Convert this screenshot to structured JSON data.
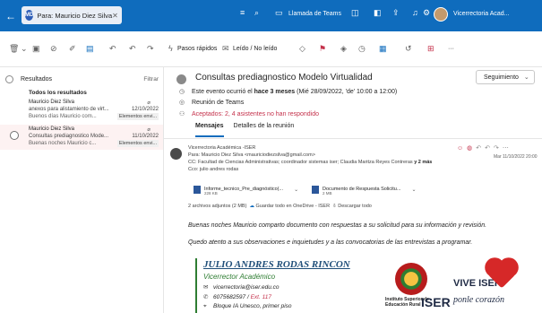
{
  "topbar": {
    "tab_initials": "MD",
    "tab_label": "Para: Mauricio Diez Silva",
    "close": "✕",
    "call_label": "Llamada de Teams",
    "account_label": "Vicerrectoria Acad..."
  },
  "ribbon": {
    "quick_steps": "Pasos rápidos",
    "read_unread": "Leído / No leído",
    "more": "···"
  },
  "list": {
    "header": "Resultados",
    "filter": "Filtrar",
    "all_results": "Todos los resultados",
    "items": [
      {
        "sender": "Mauricio Diez Silva",
        "subject": "anexos para alistamiento de virt...",
        "date": "12/10/2022",
        "preview": "Buenos días Mauricio com...",
        "chip": "Elementos envi..."
      },
      {
        "sender": "Mauricio Diez Silva",
        "subject": "Consultas prediagnostico Mode...",
        "date": "11/10/2022",
        "preview": "Buenas noches Mauricio c...",
        "chip": "Elementos envi..."
      }
    ]
  },
  "reading": {
    "subject": "Consultas prediagnostico Modelo Virtualidad",
    "follow_button": "Seguimiento",
    "event_prefix": "Este evento ocurrió el ",
    "event_bold": "hace 3 meses",
    "event_suffix": " (Mié 28/09/2022, 'de' 10:00 a 12:00)",
    "meeting": "Reunión de Teams",
    "accepted": "Aceptados: 2, 4 asistentes no han respondido",
    "tabs": [
      "Mensajes",
      "Detalles de la reunión"
    ],
    "from": "Vicerrectoria Académica -ISER",
    "to": "Para: Mauricio Diez Silva <mauriciodiezsilva@gmail.com>",
    "cc": "CC: Facultad de Ciencias Administrativas; coordinador sistemas iser; Claudia Maritza Reyes Contreras",
    "cc_more": "y 2 más",
    "cco": "Cco: julio andres rodas",
    "msg_date": "Mar 11/10/2022 20:00",
    "attachments": [
      {
        "name": "Informe_tecnico_Pre_diagnóstico(...",
        "size": "228 KB"
      },
      {
        "name": "Documento de Respuesta Solicitu...",
        "size": "2 MB"
      }
    ],
    "att_count": "2 archivos adjuntos (2 MB)",
    "save_onedrive": "Guardar todo en OneDrive - ISER",
    "download_all": "Descargar todo",
    "body_1": "Buenas noches Mauricio comparto documento con respuestas a su solicitud para su información y revisión.",
    "body_2": "Quedo atento a sus observaciones e inquietudes y a las convocatorias de las entrevistas a programar.",
    "signature": {
      "name": "JULIO ANDRES RODAS RINCON",
      "role": "Vicerrector Académico",
      "email": "vicerrectoria@iser.edu.co",
      "phone": "6075682597 / ",
      "ext": "Ext. 117",
      "address": "Bloque IA Unesco, primer piso"
    },
    "logo": {
      "institute": "Instituto Superior de Educación Rural",
      "iser": "ISER",
      "vive": "VIVE ISER",
      "slogan": "ponle corazón"
    }
  }
}
